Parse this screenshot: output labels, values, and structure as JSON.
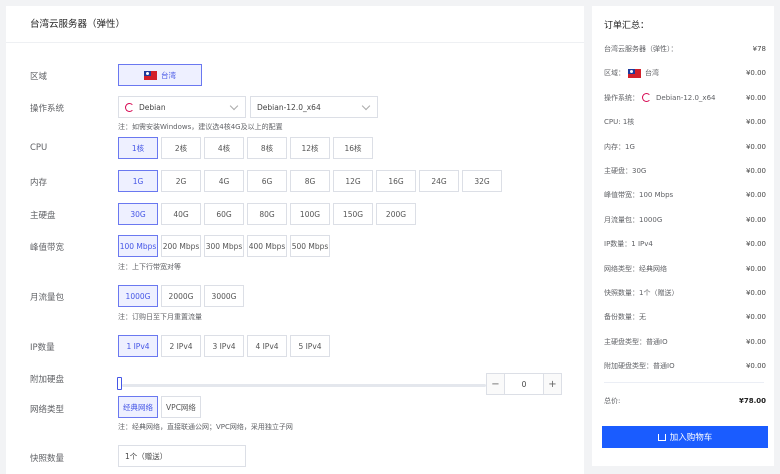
{
  "left_title": "台湾云服务器（弹性）",
  "region": {
    "label": "区域",
    "value": "台湾"
  },
  "os": {
    "label": "操作系统",
    "distro": "Debian",
    "version": "Debian-12.0_x64",
    "note": "注：如需安装Windows，建议选4核4G及以上的配置"
  },
  "cpu": {
    "label": "CPU",
    "options": [
      "1核",
      "2核",
      "4核",
      "8核",
      "12核",
      "16核"
    ],
    "selected": 0
  },
  "memory": {
    "label": "内存",
    "options": [
      "1G",
      "2G",
      "4G",
      "6G",
      "8G",
      "12G",
      "16G",
      "24G",
      "32G"
    ],
    "selected": 0
  },
  "disk": {
    "label": "主硬盘",
    "options": [
      "30G",
      "40G",
      "60G",
      "80G",
      "100G",
      "150G",
      "200G"
    ],
    "selected": 0
  },
  "bandwidth": {
    "label": "峰值带宽",
    "options": [
      "100 Mbps",
      "200 Mbps",
      "300 Mbps",
      "400 Mbps",
      "500 Mbps"
    ],
    "selected": 0,
    "note": "注：上下行带宽对等"
  },
  "traffic": {
    "label": "月流量包",
    "options": [
      "1000G",
      "2000G",
      "3000G"
    ],
    "selected": 0,
    "note": "注：订购日至下月重置流量"
  },
  "ip": {
    "label": "IP数量",
    "options": [
      "1 IPv4",
      "2 IPv4",
      "3 IPv4",
      "4 IPv4",
      "5 IPv4"
    ],
    "selected": 0
  },
  "extra_disk": {
    "label": "附加硬盘",
    "value": "0",
    "minus": "−",
    "plus": "+"
  },
  "network": {
    "label": "网络类型",
    "options": [
      "经典网络",
      "VPC网络"
    ],
    "selected": 0,
    "note": "注：经典网络，直接联通公网；VPC网络，采用独立子网"
  },
  "snapshot": {
    "label": "快照数量",
    "value": "1个（赠送）"
  },
  "summary": {
    "title": "订单汇总：",
    "rows": [
      {
        "k": "台湾云服务器（弹性）：",
        "v": "¥78"
      },
      {
        "k": "区域：",
        "extra": "台湾",
        "v": "¥0.00"
      },
      {
        "k": "操作系统：",
        "extra": "Debian-12.0_x64",
        "v": "¥0.00"
      },
      {
        "k": "CPU: 1核",
        "v": "¥0.00"
      },
      {
        "k": "内存：1G",
        "v": "¥0.00"
      },
      {
        "k": "主硬盘：30G",
        "v": "¥0.00"
      },
      {
        "k": "峰值带宽：100 Mbps",
        "v": "¥0.00"
      },
      {
        "k": "月流量包：1000G",
        "v": "¥0.00"
      },
      {
        "k": "IP数量：1 IPv4",
        "v": "¥0.00"
      },
      {
        "k": "网络类型：经典网络",
        "v": "¥0.00"
      },
      {
        "k": "快照数量：1个（赠送）",
        "v": "¥0.00"
      },
      {
        "k": "备份数量：无",
        "v": "¥0.00"
      },
      {
        "k": "主硬盘类型：普通IO",
        "v": "¥0.00"
      },
      {
        "k": "附加硬盘类型：普通IO",
        "v": "¥0.00"
      }
    ],
    "total_label": "总价:",
    "total_value": "¥78.00",
    "cart_label": "加入购物车"
  }
}
